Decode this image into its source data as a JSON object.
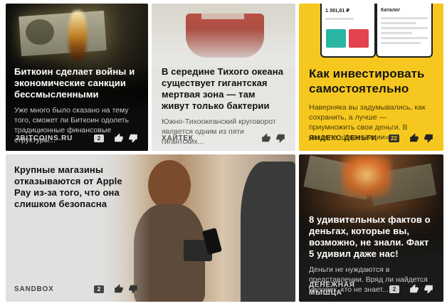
{
  "cards": [
    {
      "title": "Биткоин сделает войны и экономические санкции бессмысленными",
      "description": "Уже много было сказано на тему того, сможет ли Биткоин одолеть традиционные финансовые структуры...",
      "source": "2BITCOINS.RU",
      "comments": "2",
      "image": "burning-dollar-bill"
    },
    {
      "title": "В середине Тихого океана существует гигантская мертвая зона — там живут только бактерии",
      "description": "Южно-Тихоокеанский круговорот является одним из пяти гигантских...",
      "source": "ХАЙТЕК",
      "comments": "",
      "image": "research-ship"
    },
    {
      "title": "Как инвестировать самостоятельно",
      "description": "Наверняка вы задумывались, как сохранить, а лучше — приумножить свои деньги. В разделе «Инвестиции»...",
      "source": "ЯНДЕКС.ДЕНЬГИ",
      "comments": "22",
      "image": "investment-app-phones",
      "phone_amount": "1 391,81 ₽",
      "phone_catalog": "Каталог"
    },
    {
      "title": "Крупные магазины отказываются от Apple Pay из-за того, что она слишком безопасна",
      "description": "",
      "source": "SANDBOX",
      "comments": "2",
      "image": "cafe-payment-terminal"
    },
    {
      "title": "8 удивительных фактов о деньгах, которые вы, возможно, не знали. Факт 5 удивил даже нас!",
      "description": "Деньги не нуждаются в представлении. Вряд ли найдется человек, кто не знает...",
      "source": "ДЕНЕЖНАЯ МЫШЦА",
      "comments": "2",
      "image": "burning-money"
    }
  ],
  "colors": {
    "yellow_card": "#f6c81f",
    "dark_card": "#0c0c0c"
  },
  "icons": {
    "like": "thumb-up-icon",
    "dislike": "thumb-down-icon",
    "comments": "comment-count-badge"
  }
}
